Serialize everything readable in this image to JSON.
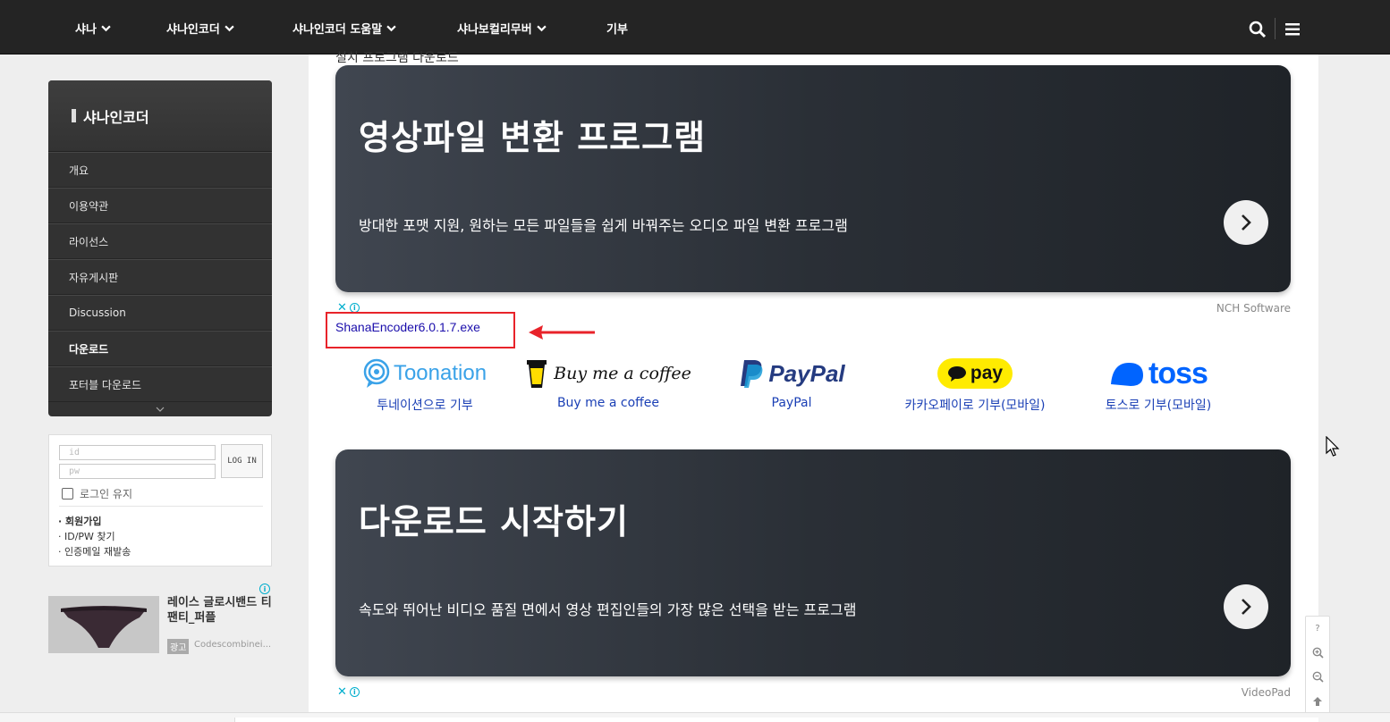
{
  "nav": {
    "items": [
      "샤나",
      "샤나인코더",
      "샤나인코더 도움말",
      "샤나보컬리무버",
      "기부"
    ],
    "search_icon": "search-icon",
    "menu_icon": "hamburger-icon"
  },
  "sidebar": {
    "title": "샤나인코더",
    "items": [
      "개요",
      "이용약관",
      "라이선스",
      "자유게시판",
      "Discussion",
      "다운로드",
      "포터블 다운로드"
    ],
    "active": "다운로드"
  },
  "login": {
    "id_placeholder": "id",
    "pw_placeholder": "pw",
    "button_label": "LOG IN",
    "remember_label": "로그인 유지",
    "links": [
      "· 회원가입",
      "· ID/PW 찾기",
      "· 인증메일 재발송"
    ]
  },
  "side_ad": {
    "title": "레이스 글로시밴드 티팬티_퍼플",
    "badge": "광고",
    "source": "Codescombinei..."
  },
  "main": {
    "cut_title": "설치 프로그램 다운로드",
    "banner1": {
      "title": "영상파일 변환 프로그램",
      "desc": "방대한 포맷 지원, 원하는 모든 파일들을 쉽게 바꿔주는 오디오 파일 변환 프로그램",
      "brand": "NCH Software"
    },
    "file_link": "ShanaEncoder6.0.1.7.exe",
    "donations": [
      {
        "logo": "Toonation",
        "label": "투네이션으로 기부"
      },
      {
        "logo": "Buy me a coffee",
        "label": "Buy me a coffee"
      },
      {
        "logo": "PayPal",
        "label": "PayPal"
      },
      {
        "logo": "pay",
        "label": "카카오페이로 기부(모바일)"
      },
      {
        "logo": "toss",
        "label": "토스로 기부(모바일)"
      }
    ],
    "banner2": {
      "title": "다운로드 시작하기",
      "desc": "속도와 뛰어난 비디오 품질 면에서 영상 편집인들의 가장 많은 선택을 받는 프로그램",
      "brand": "VideoPad"
    },
    "ad_close": "✕",
    "ad_info": "i"
  },
  "tools": [
    "?",
    "zoom-in-icon",
    "zoom-out-icon",
    "arrow-up-icon"
  ],
  "colors": {
    "nav_bg": "#242424",
    "link": "#1a0dab",
    "highlight": "#e8232a",
    "ad_accent": "#00aecd"
  }
}
